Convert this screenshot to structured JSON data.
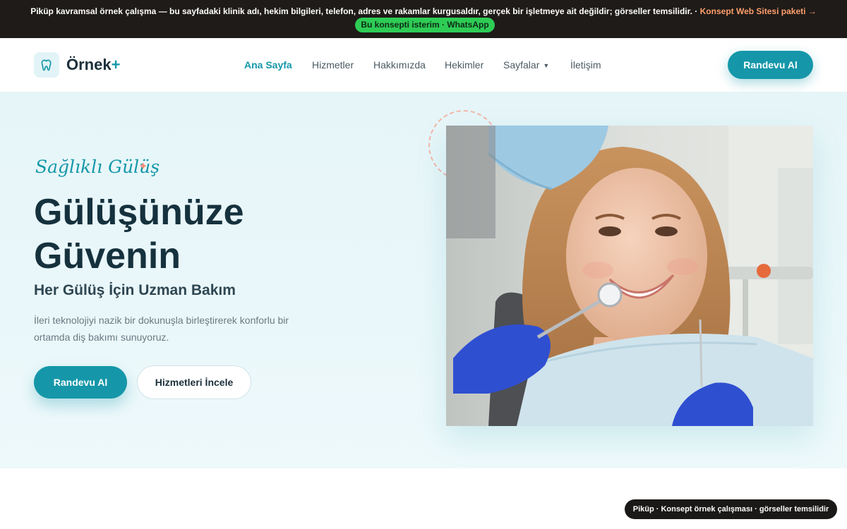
{
  "notice": {
    "brand": "Piküp",
    "lead": "kavramsal örnek çalışma",
    "text": " — bu sayfadaki klinik adı, hekim bilgileri, telefon, adres ve rakamlar ",
    "emph": "kurgusaldır",
    "text2": ", gerçek bir işletmeye ait değildir; görseller temsilidir. · ",
    "link": "Konsept Web Sitesi paketi →",
    "whatsapp": "Bu konsepti isterim · WhatsApp"
  },
  "header": {
    "logo": "Örnek",
    "logo_plus": "+",
    "nav": [
      {
        "label": "Ana Sayfa"
      },
      {
        "label": "Hizmetler"
      },
      {
        "label": "Hakkımızda"
      },
      {
        "label": "Hekimler"
      },
      {
        "label": "Sayfalar"
      },
      {
        "label": "İletişim"
      }
    ],
    "cta": "Randevu Al"
  },
  "hero": {
    "kicker": "Sağlıklı Gülüş",
    "title_line1": "Gülüşünüze",
    "title_line2": "Güvenin",
    "subtitle": "Her Gülüş İçin Uzman Bakım",
    "description": "İleri teknolojiyi nazik bir dokunuşla birleştirerek konforlu bir ortamda diş bakımı sunuyoruz.",
    "primary_button": "Randevu Al",
    "secondary_button": "Hizmetleri İncele"
  },
  "badge": "Piküp · Konsept örnek çalışması · görseller temsilidir",
  "colors": {
    "accent": "#1597a9",
    "notice_bg": "#1e1b18",
    "whatsapp": "#2ecc55",
    "link": "#ff9e6b",
    "heading": "#15313d"
  },
  "icons": {
    "logo": "tooth-icon",
    "dropdown": "caret-down-icon",
    "sparkle": "sparkle-icon"
  }
}
